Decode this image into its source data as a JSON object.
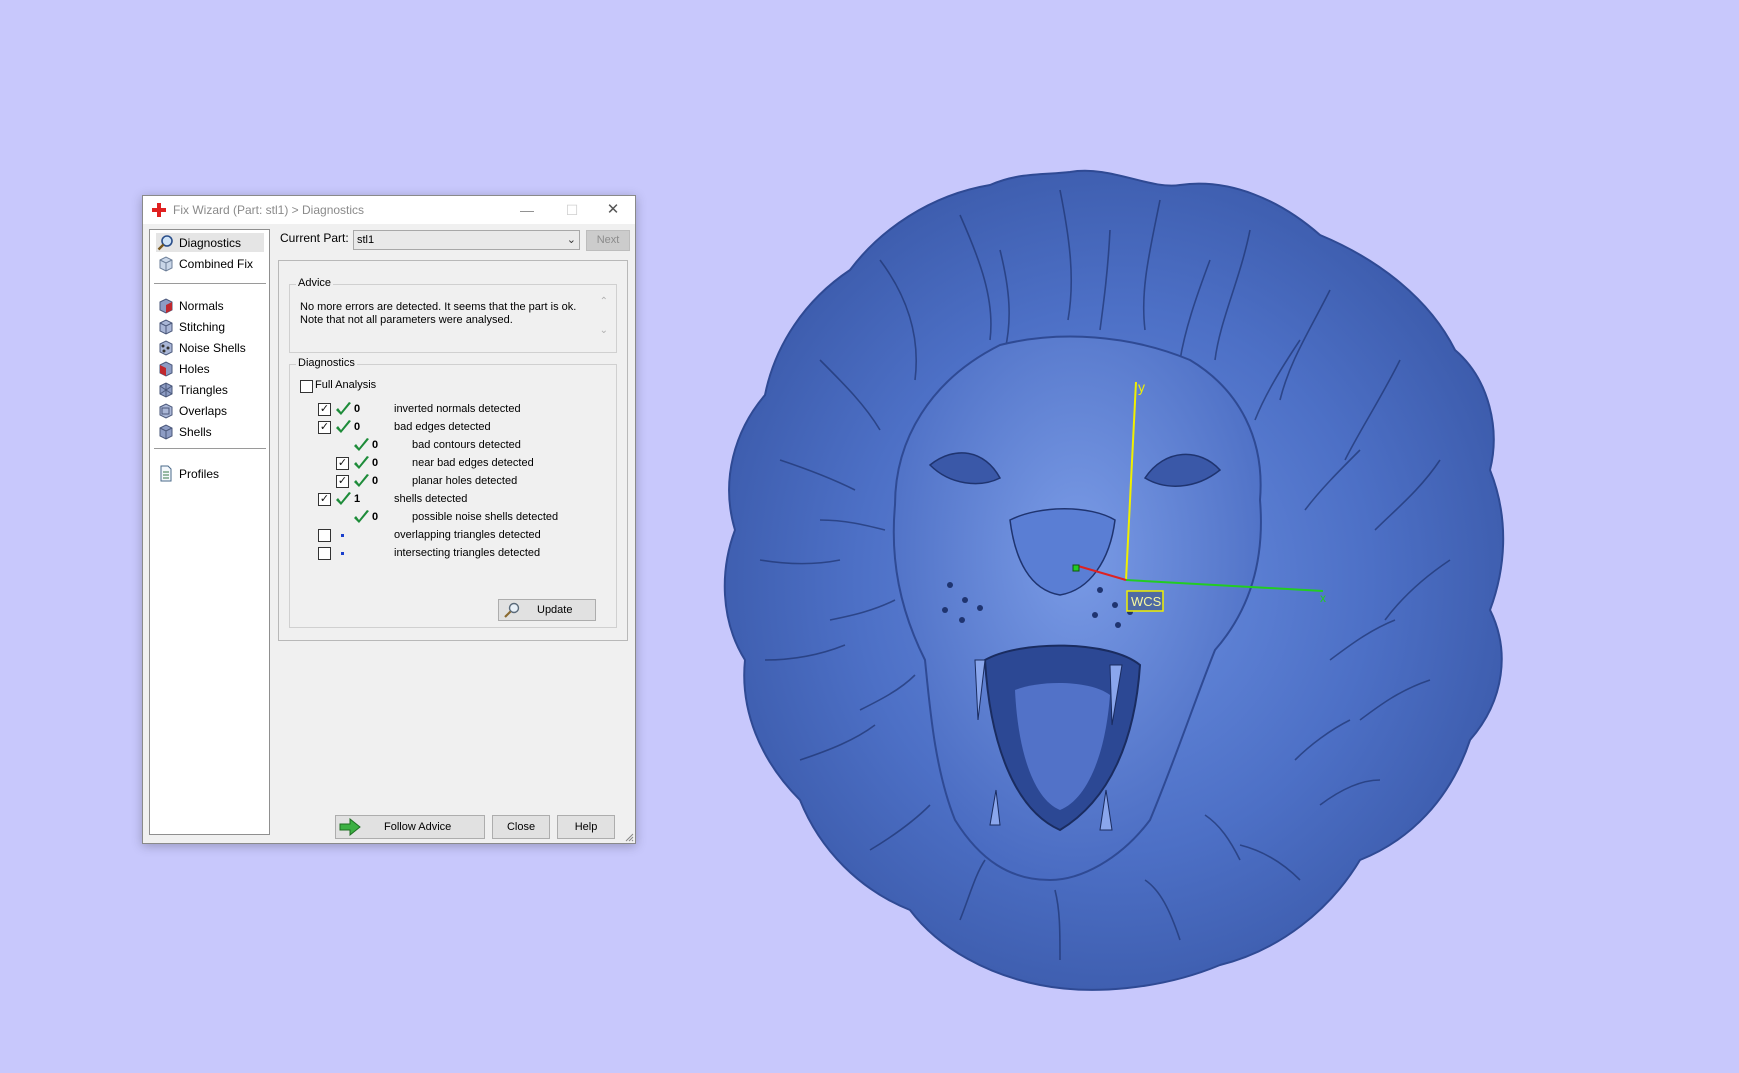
{
  "colors": {
    "background": "#c8c8fc",
    "model": "#4f73c9",
    "axis_y": "#f0f000",
    "axis_x": "#22cc22",
    "axis_z": "#dd2222",
    "check_green": "#1e8c3a"
  },
  "dialog": {
    "title": "Fix Wizard (Part: stl1) > Diagnostics",
    "title_icon": "red-cross-icon",
    "controls": {
      "minimize": "—",
      "maximize": "☐",
      "close": "✕"
    }
  },
  "sidebar": {
    "top_items": [
      {
        "label": "Diagnostics",
        "icon": "magnifier-icon",
        "selected": true
      },
      {
        "label": "Combined Fix",
        "icon": "cube-icon"
      }
    ],
    "fix_items": [
      {
        "label": "Normals",
        "icon": "normals-cube-icon"
      },
      {
        "label": "Stitching",
        "icon": "stitching-cube-icon"
      },
      {
        "label": "Noise Shells",
        "icon": "noise-shells-icon"
      },
      {
        "label": "Holes",
        "icon": "holes-cube-icon"
      },
      {
        "label": "Triangles",
        "icon": "triangles-cube-icon"
      },
      {
        "label": "Overlaps",
        "icon": "overlaps-cube-icon"
      },
      {
        "label": "Shells",
        "icon": "shells-cube-icon"
      }
    ],
    "bottom_items": [
      {
        "label": "Profiles",
        "icon": "document-icon"
      }
    ]
  },
  "current_part": {
    "label": "Current Part:",
    "value": "stl1",
    "next_label": "Next"
  },
  "advice": {
    "legend": "Advice",
    "text": "No more errors are detected. It seems that the part is ok. Note that not all parameters were analysed."
  },
  "diagnostics": {
    "legend": "Diagnostics",
    "full_analysis_label": "Full Analysis",
    "full_analysis_checked": false,
    "rows": [
      {
        "checkbox": true,
        "checked": true,
        "status": "ok",
        "count": "0",
        "label": "inverted normals detected",
        "indent": 0
      },
      {
        "checkbox": true,
        "checked": true,
        "status": "ok",
        "count": "0",
        "label": "bad edges detected",
        "indent": 0
      },
      {
        "checkbox": false,
        "status": "ok",
        "count": "0",
        "label": "bad contours detected",
        "indent": 1
      },
      {
        "checkbox": true,
        "checked": true,
        "status": "ok",
        "count": "0",
        "label": "near bad edges detected",
        "indent": 1
      },
      {
        "checkbox": true,
        "checked": true,
        "status": "ok",
        "count": "0",
        "label": "planar holes detected",
        "indent": 1
      },
      {
        "checkbox": true,
        "checked": true,
        "status": "ok",
        "count": "1",
        "label": "shells detected",
        "indent": 0
      },
      {
        "checkbox": false,
        "status": "ok",
        "count": "0",
        "label": "possible noise shells detected",
        "indent": 1
      },
      {
        "checkbox": true,
        "checked": false,
        "status": "dot",
        "count": "",
        "label": "overlapping triangles detected",
        "indent": 0
      },
      {
        "checkbox": true,
        "checked": false,
        "status": "dot",
        "count": "",
        "label": "intersecting triangles detected",
        "indent": 0
      }
    ],
    "update_label": "Update"
  },
  "buttons": {
    "follow_advice": "Follow Advice",
    "close": "Close",
    "help": "Help"
  },
  "viewport": {
    "axis_y_label": "y",
    "axis_x_label": "x",
    "wcs_label": "WCS"
  }
}
